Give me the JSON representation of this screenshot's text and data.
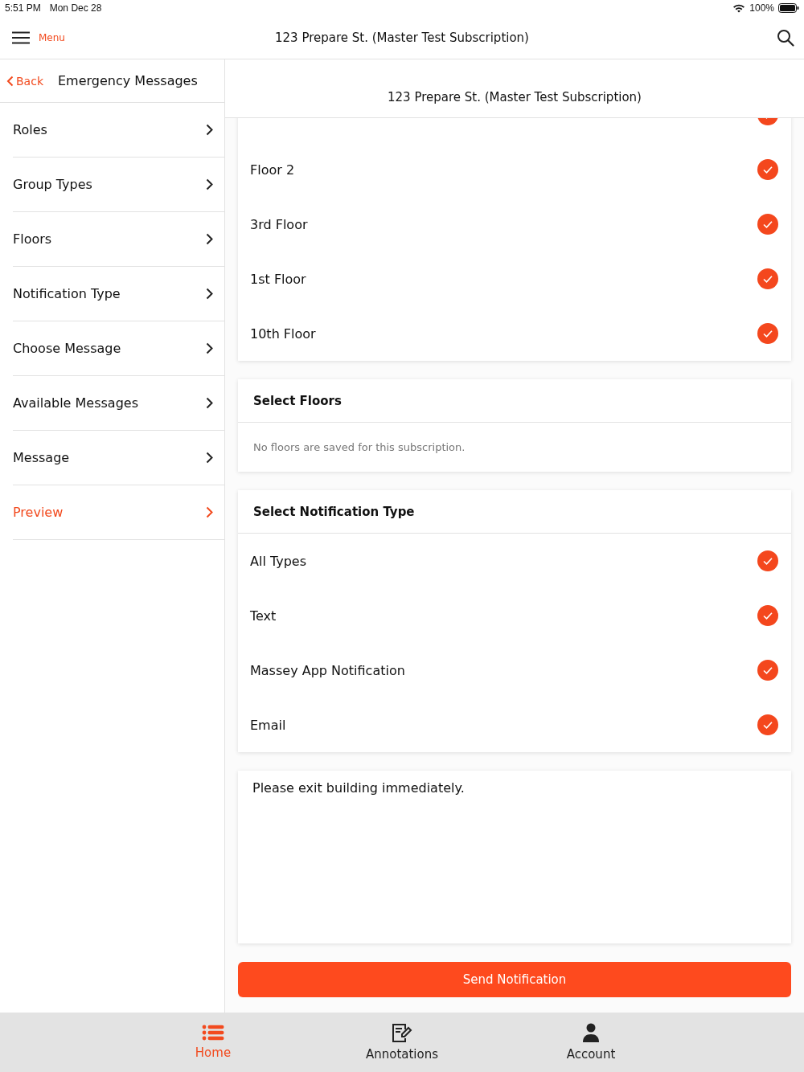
{
  "status_bar": {
    "time": "5:51 PM",
    "date": "Mon Dec 28",
    "battery": "100%"
  },
  "nav_bar": {
    "menu_label": "Menu",
    "title": "123 Prepare St. (Master Test Subscription)"
  },
  "sidebar": {
    "back_label": "Back",
    "title": "Emergency Messages",
    "items": [
      {
        "label": "Roles",
        "selected": false
      },
      {
        "label": "Group Types",
        "selected": false
      },
      {
        "label": "Floors",
        "selected": false
      },
      {
        "label": "Notification Type",
        "selected": false
      },
      {
        "label": "Choose Message",
        "selected": false
      },
      {
        "label": "Available Messages",
        "selected": false
      },
      {
        "label": "Message",
        "selected": false
      },
      {
        "label": "Preview",
        "selected": true
      }
    ]
  },
  "content": {
    "header": "123 Prepare St. (Master Test Subscription)",
    "groups": [
      {
        "checked": true
      },
      {
        "label": "Floor 2",
        "checked": true
      },
      {
        "label": "3rd Floor",
        "checked": true
      },
      {
        "label": "1st Floor",
        "checked": true
      },
      {
        "label": "10th Floor",
        "checked": true
      }
    ],
    "floors_section": {
      "title": "Select Floors",
      "empty_text": "No floors are saved for this subscription."
    },
    "notification_section": {
      "title": "Select Notification Type",
      "types": [
        {
          "label": "All Types",
          "checked": true
        },
        {
          "label": "Text",
          "checked": true
        },
        {
          "label": "Massey App Notification",
          "checked": true
        },
        {
          "label": "Email",
          "checked": true
        }
      ]
    },
    "message": "Please exit building immediately.",
    "send_button": "Send Notification"
  },
  "tab_bar": [
    {
      "label": "Home",
      "kind": "list",
      "selected": true
    },
    {
      "label": "Annotations",
      "kind": "notepad",
      "selected": false
    },
    {
      "label": "Account",
      "kind": "person",
      "selected": false
    }
  ]
}
